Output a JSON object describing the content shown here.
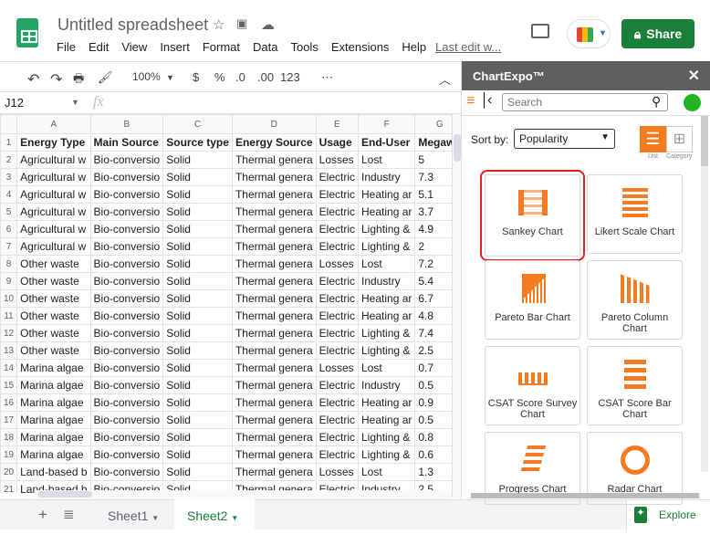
{
  "app": {
    "title": "Untitled spreadsheet",
    "menu": [
      "File",
      "Edit",
      "View",
      "Insert",
      "Format",
      "Data",
      "Tools",
      "Extensions",
      "Help"
    ],
    "last_edit": "Last edit w...",
    "share": "Share"
  },
  "toolbar": {
    "zoom": "100%",
    "currency": "$",
    "percent": "%",
    "dec_less": ".0",
    "dec_more": ".00",
    "format": "123"
  },
  "namebox": "J12",
  "fx": "fx",
  "columns": [
    "A",
    "B",
    "C",
    "D",
    "E",
    "F",
    "G"
  ],
  "rows": [
    [
      "Energy Type",
      "Main Source",
      "Source type",
      "Energy Source",
      "Usage",
      "End-User",
      "Megawa"
    ],
    [
      "Agricultural w",
      "Bio-conversio",
      "Solid",
      "Thermal genera",
      "Losses",
      "Lost",
      "5"
    ],
    [
      "Agricultural w",
      "Bio-conversio",
      "Solid",
      "Thermal genera",
      "Electric",
      "Industry",
      "7.3"
    ],
    [
      "Agricultural w",
      "Bio-conversio",
      "Solid",
      "Thermal genera",
      "Electric",
      "Heating ar",
      "5.1"
    ],
    [
      "Agricultural w",
      "Bio-conversio",
      "Solid",
      "Thermal genera",
      "Electric",
      "Heating ar",
      "3.7"
    ],
    [
      "Agricultural w",
      "Bio-conversio",
      "Solid",
      "Thermal genera",
      "Electric",
      "Lighting &",
      "4.9"
    ],
    [
      "Agricultural w",
      "Bio-conversio",
      "Solid",
      "Thermal genera",
      "Electric",
      "Lighting &",
      "2"
    ],
    [
      "Other waste",
      "Bio-conversio",
      "Solid",
      "Thermal genera",
      "Losses",
      "Lost",
      "7.2"
    ],
    [
      "Other waste",
      "Bio-conversio",
      "Solid",
      "Thermal genera",
      "Electric",
      "Industry",
      "5.4"
    ],
    [
      "Other waste",
      "Bio-conversio",
      "Solid",
      "Thermal genera",
      "Electric",
      "Heating ar",
      "6.7"
    ],
    [
      "Other waste",
      "Bio-conversio",
      "Solid",
      "Thermal genera",
      "Electric",
      "Heating ar",
      "4.8"
    ],
    [
      "Other waste",
      "Bio-conversio",
      "Solid",
      "Thermal genera",
      "Electric",
      "Lighting &",
      "7.4"
    ],
    [
      "Other waste",
      "Bio-conversio",
      "Solid",
      "Thermal genera",
      "Electric",
      "Lighting &",
      "2.5"
    ],
    [
      "Marina algae",
      "Bio-conversio",
      "Solid",
      "Thermal genera",
      "Losses",
      "Lost",
      "0.7"
    ],
    [
      "Marina algae",
      "Bio-conversio",
      "Solid",
      "Thermal genera",
      "Electric",
      "Industry",
      "0.5"
    ],
    [
      "Marina algae",
      "Bio-conversio",
      "Solid",
      "Thermal genera",
      "Electric",
      "Heating ar",
      "0.9"
    ],
    [
      "Marina algae",
      "Bio-conversio",
      "Solid",
      "Thermal genera",
      "Electric",
      "Heating ar",
      "0.5"
    ],
    [
      "Marina algae",
      "Bio-conversio",
      "Solid",
      "Thermal genera",
      "Electric",
      "Lighting &",
      "0.8"
    ],
    [
      "Marina algae",
      "Bio-conversio",
      "Solid",
      "Thermal genera",
      "Electric",
      "Lighting &",
      "0.6"
    ],
    [
      "Land-based b",
      "Bio-conversio",
      "Solid",
      "Thermal genera",
      "Losses",
      "Lost",
      "1.3"
    ],
    [
      "Land-based b",
      "Bio-conversio",
      "Solid",
      "Thermal genera",
      "Electric",
      "Industry",
      "2.5"
    ]
  ],
  "sheets": [
    {
      "label": "Sheet1",
      "active": false
    },
    {
      "label": "Sheet2",
      "active": true
    }
  ],
  "explore": "Explore",
  "panel": {
    "title": "ChartExpo™",
    "search_placeholder": "Search",
    "sort_label": "Sort by:",
    "sort_value": "Popularity",
    "view_list": "List",
    "view_category": "Category",
    "charts": [
      "Sankey Chart",
      "Likert Scale Chart",
      "Pareto Bar Chart",
      "Pareto Column Chart",
      "CSAT Score Survey Chart",
      "CSAT Score Bar Chart",
      "Progress Chart",
      "Radar Chart"
    ],
    "selected": "Sankey Chart",
    "accent": "#f47b20"
  }
}
